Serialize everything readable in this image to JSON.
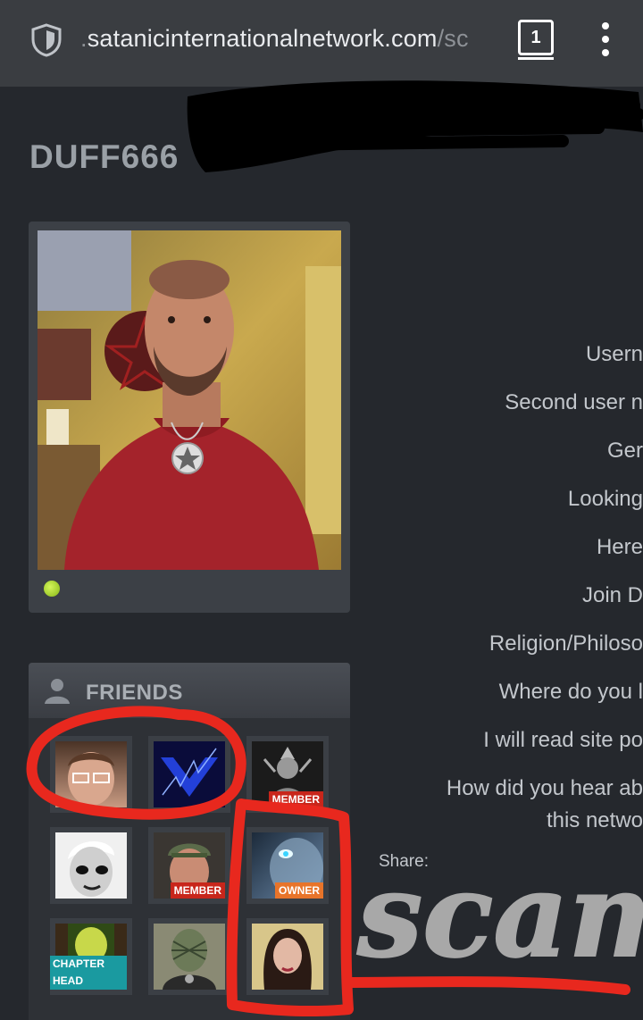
{
  "browser": {
    "url_prefix": ".",
    "url_main": "satanicinternationalnetwork.com",
    "url_suffix": "/sc",
    "tab_count": "1"
  },
  "profile": {
    "username": "DUFF666"
  },
  "friends": {
    "title": "FRIENDS",
    "items": [
      {
        "badge": ""
      },
      {
        "badge": ""
      },
      {
        "badge": "MEMBER"
      },
      {
        "badge": ""
      },
      {
        "badge": "MEMBER"
      },
      {
        "badge": "OWNER"
      },
      {
        "badge": "CHAPTER HEAD"
      },
      {
        "badge": ""
      },
      {
        "badge": ""
      }
    ]
  },
  "fields": [
    "Usern",
    "Second user n",
    "Ger",
    "Looking",
    "Here",
    "Join D",
    "Religion/Philoso",
    "Where do you l",
    "I will read site po",
    "How did you hear ab",
    "this netwo"
  ],
  "share_label": "Share:",
  "annotation_text": "scam",
  "colors": {
    "background": "#25282d",
    "card": "#3c4046",
    "member_badge": "#c8261b",
    "owner_badge": "#e8742a",
    "chapter_badge": "#1a9aa0",
    "annotation": "#e8281e",
    "online": "#9ad21f"
  }
}
